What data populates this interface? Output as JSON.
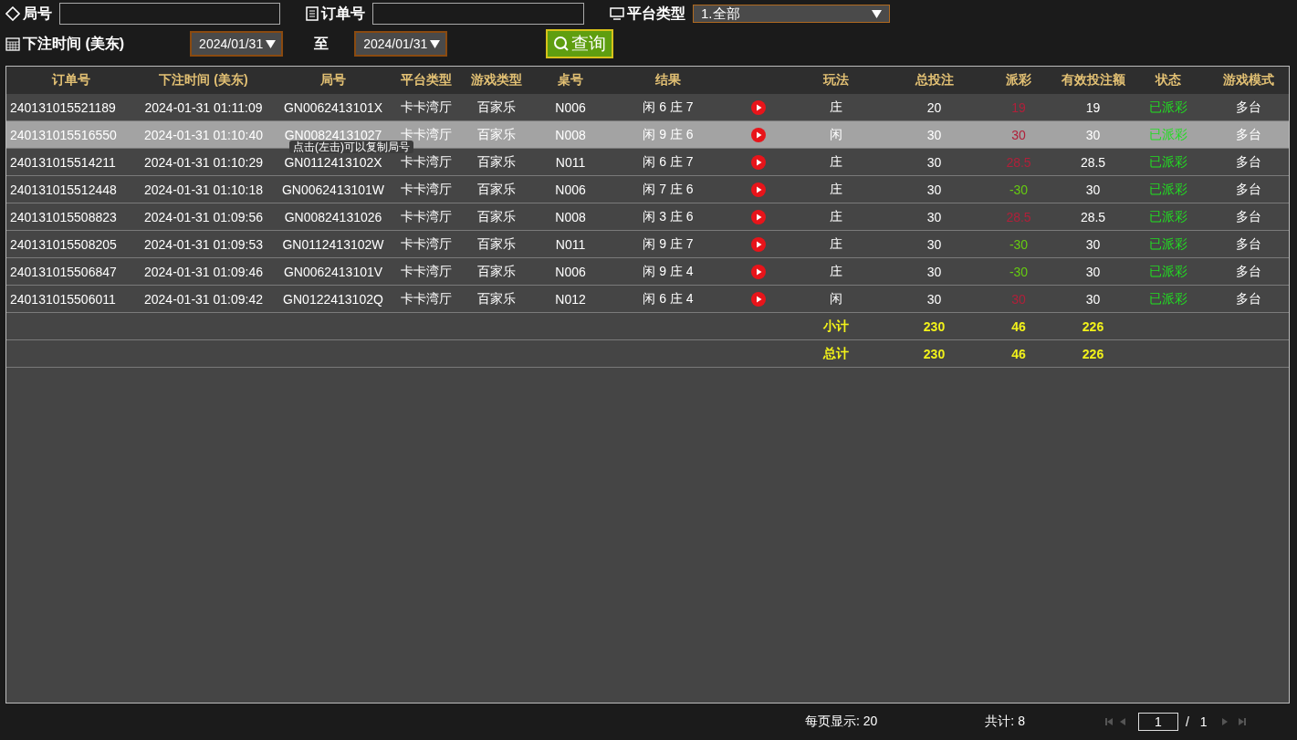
{
  "filters": {
    "round_label": "局号",
    "order_label": "订单号",
    "platform_label": "平台类型",
    "platform_value": "1.全部",
    "time_label": "下注时间 (美东)",
    "date_from": "2024/01/31",
    "to_label": "至",
    "date_to": "2024/01/31",
    "query_button": "查询"
  },
  "table": {
    "columns": [
      "订单号",
      "下注时间 (美东)",
      "局号",
      "平台类型",
      "游戏类型",
      "桌号",
      "结果",
      "玩法",
      "总投注",
      "派彩",
      "有效投注额",
      "状态",
      "游戏模式"
    ],
    "rows": [
      {
        "order": "240131015521189",
        "time": "2024-01-31 01:11:09",
        "round": "GN0062413101X",
        "platform": "卡卡湾厅",
        "game": "百家乐",
        "table_no": "N006",
        "result": "闲 6 庄 7",
        "bet": "庄",
        "total": "20",
        "payout": "19",
        "color": "#b0203a",
        "valid": "19",
        "status": "已派彩",
        "mode": "多台",
        "selected": false
      },
      {
        "order": "240131015516550",
        "time": "2024-01-31 01:10:40",
        "round": "GN00824131027",
        "platform": "卡卡湾厅",
        "game": "百家乐",
        "table_no": "N008",
        "result": "闲 9 庄 6",
        "bet": "闲",
        "total": "30",
        "payout": "30",
        "color": "#b0203a",
        "valid": "30",
        "status": "已派彩",
        "mode": "多台",
        "selected": true
      },
      {
        "order": "240131015514211",
        "time": "2024-01-31 01:10:29",
        "round": "GN0112413102X",
        "platform": "卡卡湾厅",
        "game": "百家乐",
        "table_no": "N011",
        "result": "闲 6 庄 7",
        "bet": "庄",
        "total": "30",
        "payout": "28.5",
        "color": "#b0203a",
        "valid": "28.5",
        "status": "已派彩",
        "mode": "多台",
        "selected": false
      },
      {
        "order": "240131015512448",
        "time": "2024-01-31 01:10:18",
        "round": "GN0062413101W",
        "platform": "卡卡湾厅",
        "game": "百家乐",
        "table_no": "N006",
        "result": "闲 7 庄 6",
        "bet": "庄",
        "total": "30",
        "payout": "-30",
        "color": "#66cc11",
        "valid": "30",
        "status": "已派彩",
        "mode": "多台",
        "selected": false
      },
      {
        "order": "240131015508823",
        "time": "2024-01-31 01:09:56",
        "round": "GN00824131026",
        "platform": "卡卡湾厅",
        "game": "百家乐",
        "table_no": "N008",
        "result": "闲 3 庄 6",
        "bet": "庄",
        "total": "30",
        "payout": "28.5",
        "color": "#b0203a",
        "valid": "28.5",
        "status": "已派彩",
        "mode": "多台",
        "selected": false
      },
      {
        "order": "240131015508205",
        "time": "2024-01-31 01:09:53",
        "round": "GN0112413102W",
        "platform": "卡卡湾厅",
        "game": "百家乐",
        "table_no": "N011",
        "result": "闲 9 庄 7",
        "bet": "庄",
        "total": "30",
        "payout": "-30",
        "color": "#66cc11",
        "valid": "30",
        "status": "已派彩",
        "mode": "多台",
        "selected": false
      },
      {
        "order": "240131015506847",
        "time": "2024-01-31 01:09:46",
        "round": "GN0062413101V",
        "platform": "卡卡湾厅",
        "game": "百家乐",
        "table_no": "N006",
        "result": "闲 9 庄 4",
        "bet": "庄",
        "total": "30",
        "payout": "-30",
        "color": "#66cc11",
        "valid": "30",
        "status": "已派彩",
        "mode": "多台",
        "selected": false
      },
      {
        "order": "240131015506011",
        "time": "2024-01-31 01:09:42",
        "round": "GN0122413102Q",
        "platform": "卡卡湾厅",
        "game": "百家乐",
        "table_no": "N012",
        "result": "闲 6 庄 4",
        "bet": "闲",
        "total": "30",
        "payout": "30",
        "color": "#b0203a",
        "valid": "30",
        "status": "已派彩",
        "mode": "多台",
        "selected": false
      }
    ],
    "totals": [
      {
        "label": "小计",
        "total": "230",
        "payout": "46",
        "valid": "226"
      },
      {
        "label": "总计",
        "total": "230",
        "payout": "46",
        "valid": "226"
      }
    ]
  },
  "tooltip": "点击(左击)可以复制局号",
  "footer": {
    "page_size": "每页显示: 20",
    "count": "共计: 8",
    "page": "1",
    "separator": "/",
    "pages": "1"
  }
}
